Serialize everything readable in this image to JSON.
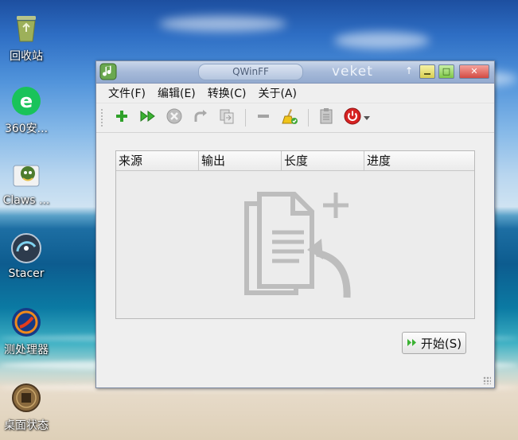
{
  "desktop": {
    "icons": [
      {
        "label": "回收站",
        "icon": "recycle-bin-icon"
      },
      {
        "label": "360安...",
        "icon": "browser-360-icon"
      },
      {
        "label": "Claws ...",
        "icon": "claws-mail-icon"
      },
      {
        "label": "Stacer",
        "icon": "stacer-icon"
      },
      {
        "label": "测处理器",
        "icon": "processor-test-icon"
      },
      {
        "label": "桌面状态",
        "icon": "desktop-status-icon"
      }
    ]
  },
  "window": {
    "app_title": "QWinFF",
    "host_label": "veket",
    "controls": {
      "pin": "↑",
      "maximize": "□",
      "close": "✕"
    },
    "menu": [
      "文件(F)",
      "编辑(E)",
      "转换(C)",
      "关于(A)"
    ],
    "toolbar": [
      {
        "icon": "add-icon"
      },
      {
        "icon": "fast-forward-icon"
      },
      {
        "icon": "stop-icon"
      },
      {
        "icon": "redo-icon"
      },
      {
        "icon": "copy-icon"
      },
      {
        "icon": "remove-icon"
      },
      {
        "icon": "clean-brush-icon"
      },
      {
        "icon": "clipboard-icon"
      },
      {
        "icon": "power-icon"
      }
    ],
    "table": {
      "columns": [
        "来源",
        "输出",
        "长度",
        "进度"
      ],
      "rows": []
    },
    "start_button": {
      "label": "开始(S)"
    }
  },
  "colors": {
    "accent_green": "#3bb233",
    "power_red": "#d62222",
    "window_bg": "#efefef"
  }
}
